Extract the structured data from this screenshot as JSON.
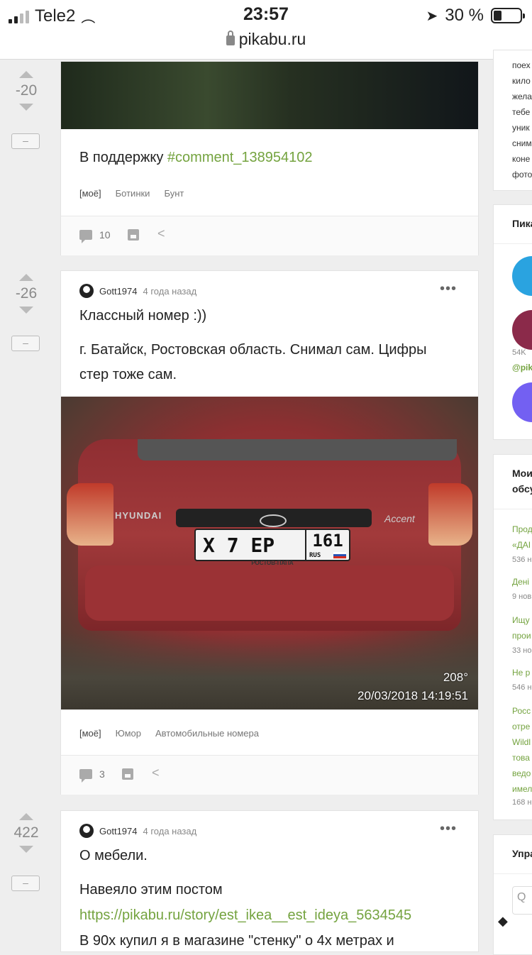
{
  "status_bar": {
    "carrier": "Tele2",
    "time": "23:57",
    "url": "pikabu.ru",
    "battery": "30 %"
  },
  "posts": [
    {
      "score": "-20",
      "minus_label": "–",
      "comment_text": "В поддержку",
      "comment_link": "#comment_138954102",
      "tags": [
        "[моё]",
        "Ботинки",
        "Бунт"
      ],
      "comments_count": "10"
    },
    {
      "score": "-26",
      "minus_label": "–",
      "author": "Gott1974",
      "time": "4 года назад",
      "title": "Классный номер :))",
      "text": "г. Батайск, Ростовская область. Снимал сам. Цифры стер тоже сам.",
      "photo": {
        "brand_left": "HYUNDAI",
        "brand_right": "Accent",
        "plate_main": "X 7 EP",
        "plate_region": "161",
        "plate_country": "RUS",
        "plate_frame": "РОСТОВ-ПАПА",
        "stamp_angle": "208°",
        "stamp_date": "20/03/2018 14:19:51"
      },
      "tags": [
        "[моё]",
        "Юмор",
        "Автомобильные номера"
      ],
      "comments_count": "3"
    },
    {
      "score": "422",
      "minus_label": "–",
      "author": "Gott1974",
      "time": "4 года назад",
      "title": "О мебели.",
      "text_1": "Навеяло этим постом",
      "link": "https://pikabu.ru/story/est_ikea__est_ideya_5634545",
      "text_2": "В 90х купил я в магазине \"стенку\" о 4х метрах и"
    }
  ],
  "sidebar": {
    "top_text": [
      "поех",
      "кило",
      "жела",
      "тебе",
      "уник",
      "сним",
      "коне",
      "фото"
    ],
    "social_heading": "Пика",
    "social_count": "54K",
    "social_handle": "@pik",
    "discussions_heading_1": "Мои",
    "discussions_heading_2": "обсу",
    "discussions": [
      {
        "lines": [
          "Прод",
          "«ДАІ"
        ],
        "meta": "536 н"
      },
      {
        "lines": [
          "Дені"
        ],
        "meta": "9 нов"
      },
      {
        "lines": [
          "Ищу",
          "прои"
        ],
        "meta": "33 но"
      },
      {
        "lines": [
          "Не р"
        ],
        "meta": "546 н"
      },
      {
        "lines": [
          "Росс",
          "отре",
          "Wildl",
          "това",
          "ведо",
          "имел"
        ],
        "meta": "168 н"
      }
    ],
    "manage_heading": "Упра",
    "search_placeholder": "Q"
  },
  "colors": {
    "link": "#74a33f",
    "telegram": "#2aa3e0",
    "telegram_dark": "#8b2a4a",
    "viber": "#7360f2"
  }
}
